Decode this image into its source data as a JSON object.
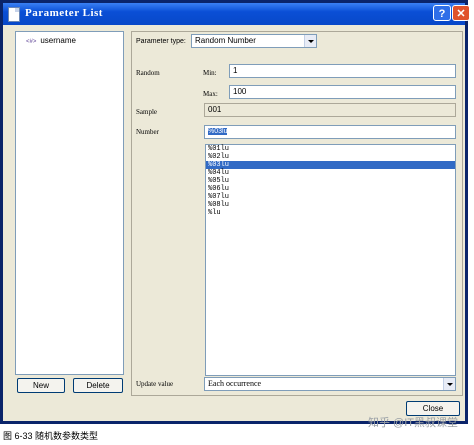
{
  "window": {
    "title": "Parameter List"
  },
  "tree": {
    "items": [
      {
        "tag": "<#>",
        "label": "username"
      }
    ]
  },
  "buttons": {
    "new": "New",
    "delete": "Delete",
    "close": "Close"
  },
  "parameter_type": {
    "label": "Parameter type:",
    "value": "Random Number"
  },
  "random": {
    "label": "Random",
    "min_label": "Min:",
    "min_value": "1",
    "max_label": "Max:",
    "max_value": "100"
  },
  "sample": {
    "label": "Sample",
    "value": "001"
  },
  "number": {
    "label": "Number",
    "value": "%03lu",
    "options": [
      "%01lu",
      "%02lu",
      "%03lu",
      "%04lu",
      "%05lu",
      "%06lu",
      "%07lu",
      "%08lu",
      "%lu"
    ],
    "selected_index": 2
  },
  "update_value": {
    "label": "Update value",
    "value": "Each occurrence"
  },
  "caption": "图 6-33  随机数参数类型",
  "watermark": "知乎 @IT黑叔课堂",
  "colors": {
    "title_bar": "#0a4fd6",
    "selection": "#316ac5",
    "window_bg": "#ece9d8"
  }
}
